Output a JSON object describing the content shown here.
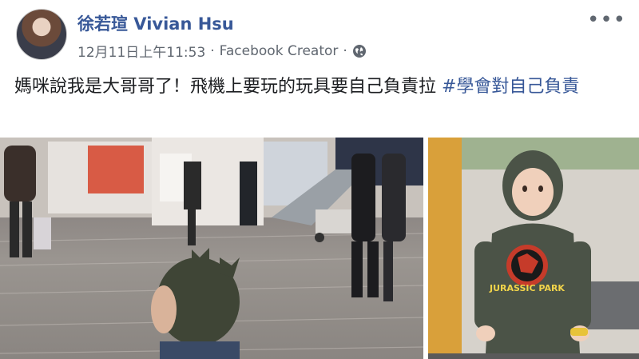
{
  "post": {
    "author": "徐若瑄 Vivian Hsu",
    "timestamp": "12月11日上午11:53",
    "separator": "·",
    "app": "Facebook Creator",
    "privacy_icon": "globe-icon",
    "more_icon": "more-horizontal-icon",
    "text": "媽咪說我是大哥哥了！飛機上要玩的玩具要自己負責拉 ",
    "hashtag": "#學會對自己負責"
  },
  "photos": {
    "main_alt": "Child in green dinosaur hoodie walking at airport terminal",
    "side_alt": "Child wearing Jurassic Park hoodie",
    "side_shirt_text": "JURASSIC PARK"
  },
  "colors": {
    "link": "#385898",
    "text": "#1c1e21",
    "meta": "#606770"
  }
}
